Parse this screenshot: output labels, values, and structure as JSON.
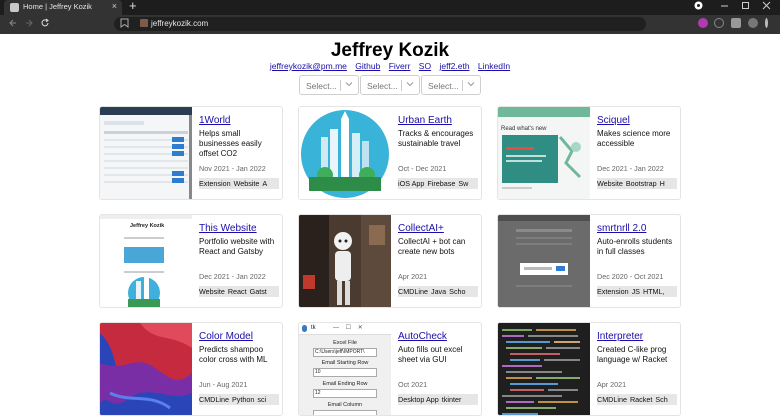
{
  "browser": {
    "tab_title": "Home | Jeffrey Kozik",
    "tab_close": "×",
    "new_tab": "+",
    "url": "jeffreykozik.com"
  },
  "header": {
    "name": "Jeffrey Kozik",
    "links": [
      "jeffreykozik@pm.me",
      "Github",
      "Fiverr",
      "SO",
      "jeff2.eth",
      "LinkedIn"
    ]
  },
  "filters": [
    {
      "placeholder": "Select..."
    },
    {
      "placeholder": "Select..."
    },
    {
      "placeholder": "Select..."
    }
  ],
  "projects": [
    {
      "title": "1World",
      "desc": "Helps small businesses easily offset CO2",
      "date": "Nov 2021 - Jan 2022",
      "tags": [
        "Extension",
        "Website",
        "A"
      ]
    },
    {
      "title": "Urban Earth",
      "desc": "Tracks & encourages sustainable travel",
      "date": "Oct - Dec 2021",
      "tags": [
        "iOS App",
        "Firebase",
        "Sw"
      ]
    },
    {
      "title": "Sciquel",
      "desc": "Makes science more accessible",
      "date": "Dec 2021 - Jan 2022",
      "tags": [
        "Website",
        "Bootstrap",
        "H"
      ]
    },
    {
      "title": "This Website",
      "desc": "Portfolio website with React and Gatsby",
      "date": "Dec 2021 - Jan 2022",
      "tags": [
        "Website",
        "React",
        "Gatst"
      ]
    },
    {
      "title": "CollectAI+",
      "desc": "CollectAI + bot can create new bots",
      "date": "Apr 2021",
      "tags": [
        "CMDLine",
        "Java",
        "Scho"
      ]
    },
    {
      "title": "smrtnrll 2.0",
      "desc": "Auto-enrolls students in full classes",
      "date": "Dec 2020 - Oct 2021",
      "tags": [
        "Extension",
        "JS",
        "HTML,"
      ]
    },
    {
      "title": "Color Model",
      "desc": "Predicts shampoo color cross with ML",
      "date": "Jun - Aug 2021",
      "tags": [
        "CMDLine",
        "Python",
        "sci"
      ]
    },
    {
      "title": "AutoCheck",
      "desc": "Auto fills out excel sheet via GUI",
      "date": "Oct 2021",
      "tags": [
        "Desktop App",
        "tkinter"
      ]
    },
    {
      "title": "Interpreter",
      "desc": "Created C-like prog language w/ Racket",
      "date": "Apr 2021",
      "tags": [
        "CMDLine",
        "Racket",
        "Sch"
      ]
    }
  ],
  "thumb_text": {
    "p3_heading": "Read what's new",
    "p4_heading": "Jeffrey Kozik",
    "p8_title": "tk",
    "p8_labels": [
      "Excel File",
      "Email Starting Row",
      "Email Ending Row",
      "Email Column"
    ],
    "p8_values": [
      "C:\\Users\\jeff\\IMPORT\\",
      "10",
      "12"
    ]
  }
}
